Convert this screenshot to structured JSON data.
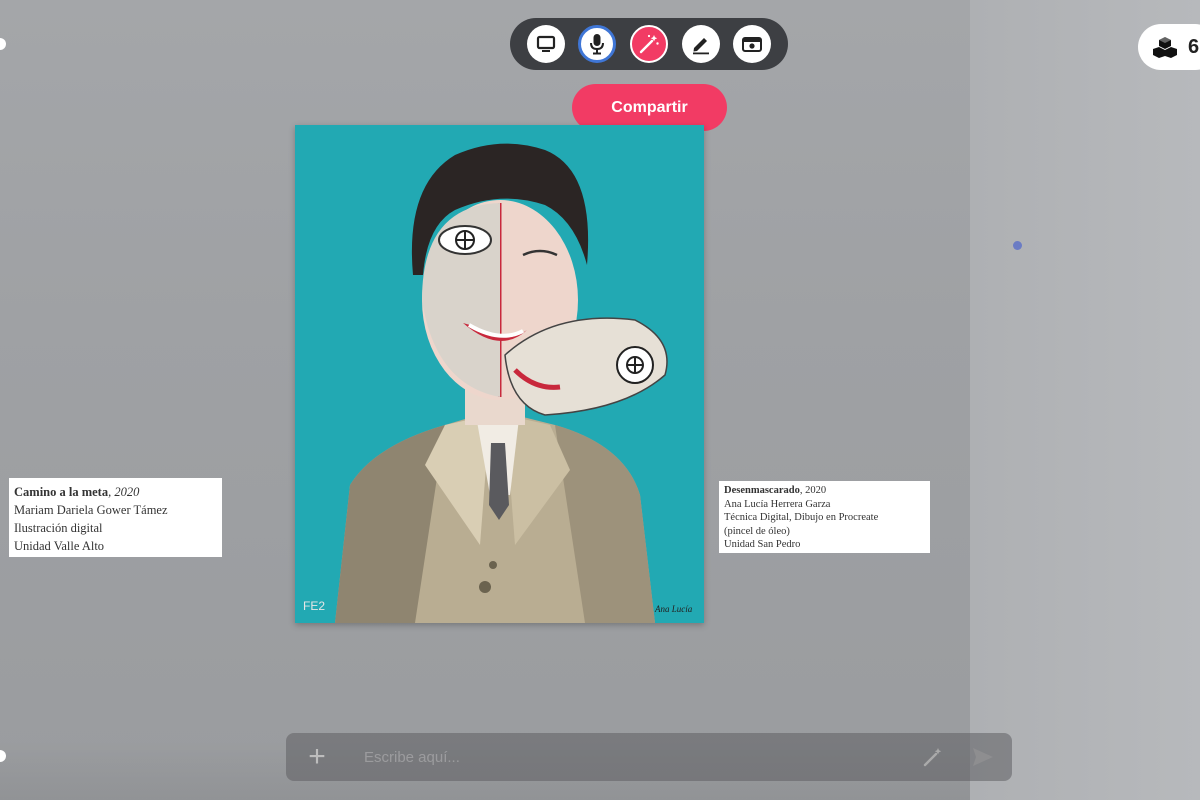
{
  "toolbar": {
    "tools": [
      {
        "icon": "screen-icon"
      },
      {
        "icon": "microphone-icon"
      },
      {
        "icon": "magic-wand-icon",
        "active": true
      },
      {
        "icon": "pencil-icon"
      },
      {
        "icon": "camera-icon"
      }
    ],
    "accent_color": "#f23b64",
    "mic_ring_color": "#3f76d6"
  },
  "share_button": {
    "label": "Compartir"
  },
  "top_right": {
    "icon": "cubes-icon",
    "text": "6"
  },
  "artwork_left": {
    "title": "Camino a la meta",
    "year": ", 2020",
    "artist": "Mariam Dariela Gower Támez",
    "technique": "Ilustración  digital",
    "unit": "Unidad Valle Alto"
  },
  "artwork_right": {
    "title": "Desenmascarado",
    "year": ", 2020",
    "artist": "Ana Lucía Herrera Garza",
    "technique_line1": "Técnica Digital, Dibujo en Procreate",
    "technique_line2": "(pincel de óleo)",
    "unit": "Unidad San Pedro"
  },
  "chat": {
    "placeholder": "Escribe aquí...",
    "add_icon": "plus-icon",
    "wand_icon": "magic-wand-icon",
    "send_icon": "send-icon"
  }
}
